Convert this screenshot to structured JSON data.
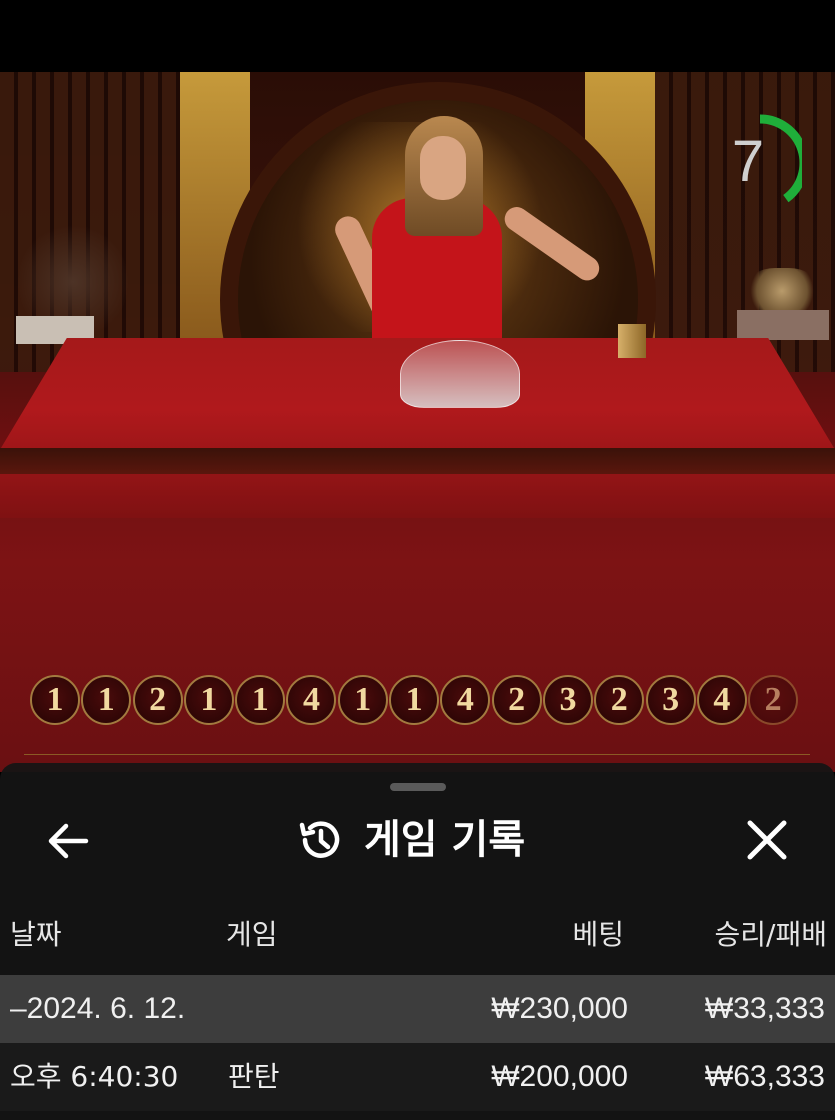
{
  "timer": {
    "value": "7",
    "progress": 0.4,
    "color": "#1fae3a"
  },
  "beads": [
    "1",
    "1",
    "2",
    "1",
    "1",
    "4",
    "1",
    "1",
    "4",
    "2",
    "3",
    "2",
    "3",
    "4",
    "2"
  ],
  "sheet": {
    "title": "게임 기록",
    "headers": {
      "date": "날짜",
      "game": "게임",
      "bet": "베팅",
      "result": "승리/패배"
    },
    "group_row": {
      "date": "–2024. 6. 12.",
      "bet": "₩230,000",
      "result": "₩33,333"
    },
    "item_row": {
      "time": "오후 6:40:30",
      "game": "판탄",
      "bet": "₩200,000",
      "result": "₩63,333"
    }
  }
}
